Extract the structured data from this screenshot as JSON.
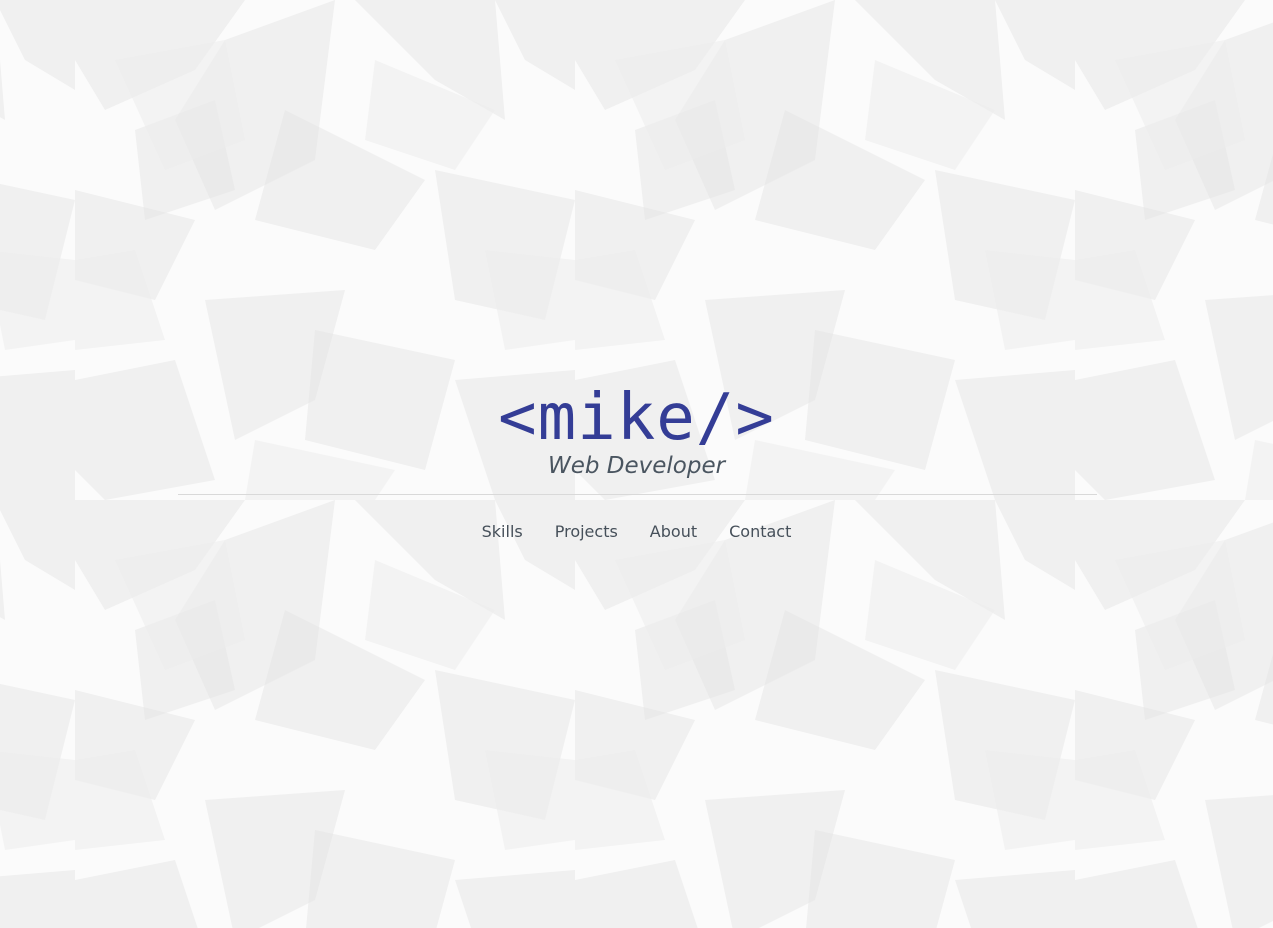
{
  "hero": {
    "logo": "<mike/>",
    "subtitle": "Web Developer"
  },
  "nav": {
    "items": [
      {
        "label": "Skills"
      },
      {
        "label": "Projects"
      },
      {
        "label": "About"
      },
      {
        "label": "Contact"
      }
    ]
  },
  "colors": {
    "background": "#fbfbfb",
    "pattern_shape": "#e6e6e6",
    "logo": "#343d96",
    "subtitle": "#4a5560",
    "nav_link": "#46505a",
    "divider": "#d9d9d9"
  }
}
